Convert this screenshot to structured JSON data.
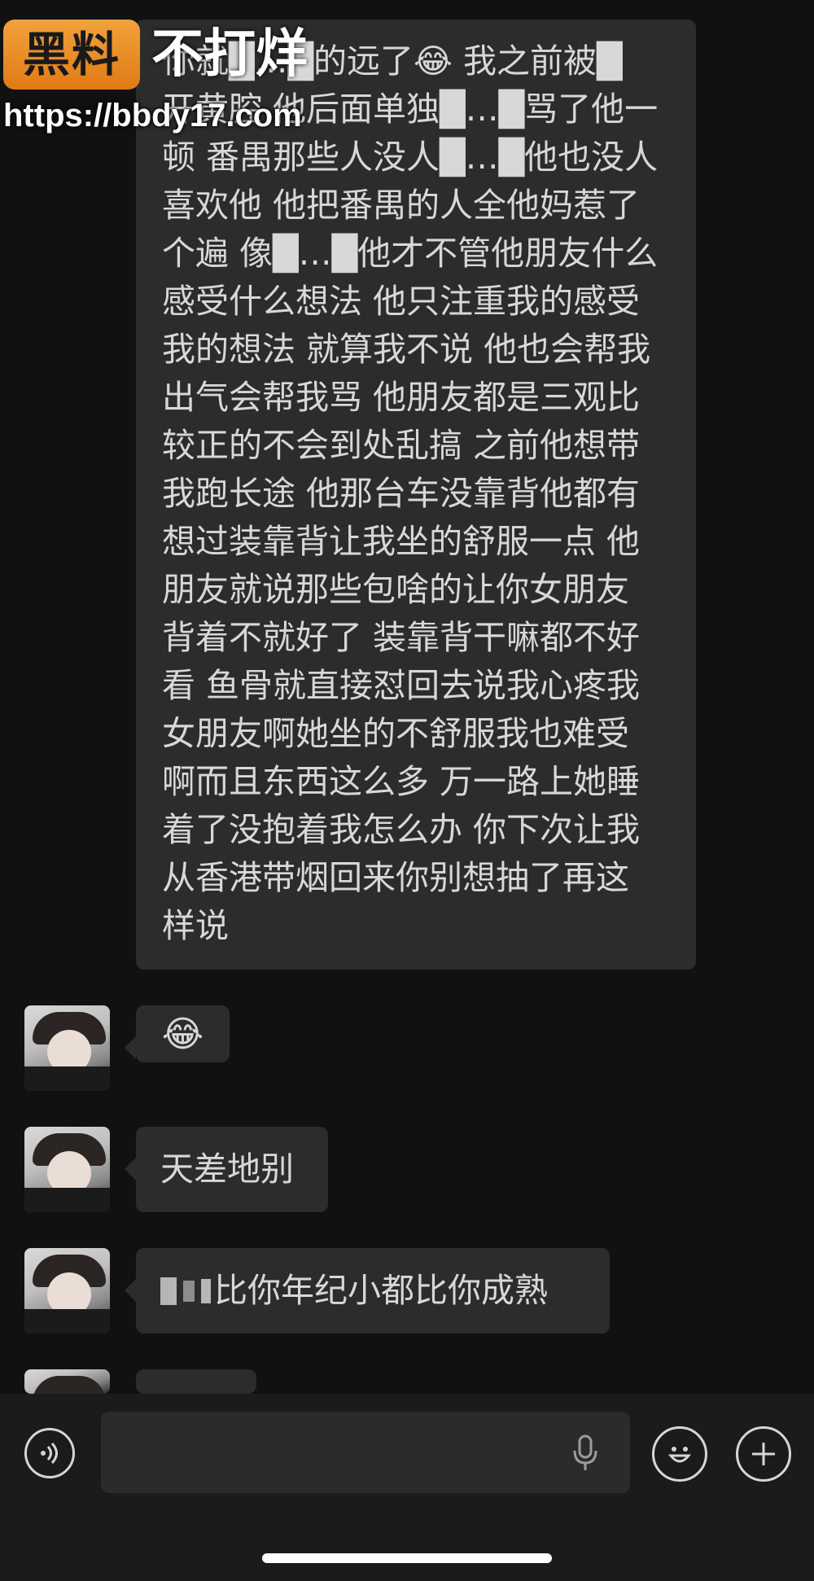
{
  "messages": [
    {
      "lines": [
        "你就█…█的远了😂 我之前被█",
        "开黄腔 他后面单独█…█骂了他一",
        "顿 番禺那些人没人█…█他也没人",
        "喜欢他 他把番禺的人全他妈惹了",
        "个遍 像█…█他才不管他朋友什么",
        "感受什么想法 他只注重我的感受",
        "我的想法 就算我不说 他也会帮我",
        "出气会帮我骂 他朋友都是三观比",
        "较正的不会到处乱搞 之前他想带",
        "我跑长途 他那台车没靠背他都有",
        "想过装靠背让我坐的舒服一点 他",
        "朋友就说那些包啥的让你女朋友",
        "背着不就好了 装靠背干嘛都不好",
        "看 鱼骨就直接怼回去说我心疼我",
        "女朋友啊她坐的不舒服我也难受",
        "啊而且东西这么多 万一路上她睡",
        "着了没抱着我怎么办 你下次让我",
        "从香港带烟回来你别想抽了再这",
        "样说"
      ]
    },
    {
      "text": "😂"
    },
    {
      "text": "天差地别"
    },
    {
      "text": "比你年纪小都比你成熟"
    }
  ],
  "watermark": {
    "logo": "黑料",
    "title": "不打烊",
    "url": "https://bbdy17.com"
  },
  "icons": {
    "voice": "voice-icon",
    "mic": "mic-icon",
    "emoji": "emoji-icon",
    "plus": "plus-icon"
  },
  "colors": {
    "background": "#111111",
    "bubble": "#2c2c2c",
    "text": "#d8d8d8",
    "watermark_logo": "#e88a22"
  }
}
